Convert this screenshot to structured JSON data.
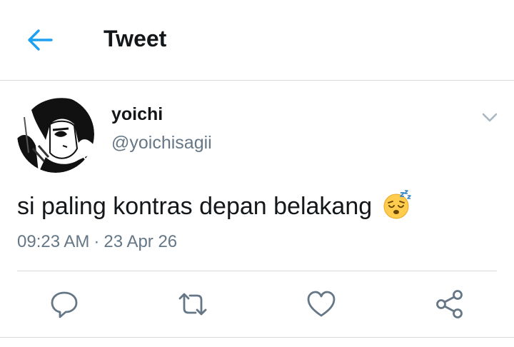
{
  "header": {
    "title": "Tweet",
    "back_icon": "arrow-left-icon",
    "accent_color": "#1da1f2"
  },
  "tweet": {
    "display_name": "yoichi",
    "handle": "@yoichisagii",
    "text": "si paling kontras depan belakang",
    "emoji": "sleeping-face",
    "time": "09:23 AM",
    "date": "23 Apr 26",
    "separator": "·"
  },
  "actions": {
    "reply_icon": "reply-icon",
    "retweet_icon": "retweet-icon",
    "like_icon": "heart-icon",
    "share_icon": "share-icon"
  },
  "colors": {
    "text": "#14171a",
    "secondary": "#657786",
    "icon": "#657786",
    "divider": "#d9d9d9"
  }
}
